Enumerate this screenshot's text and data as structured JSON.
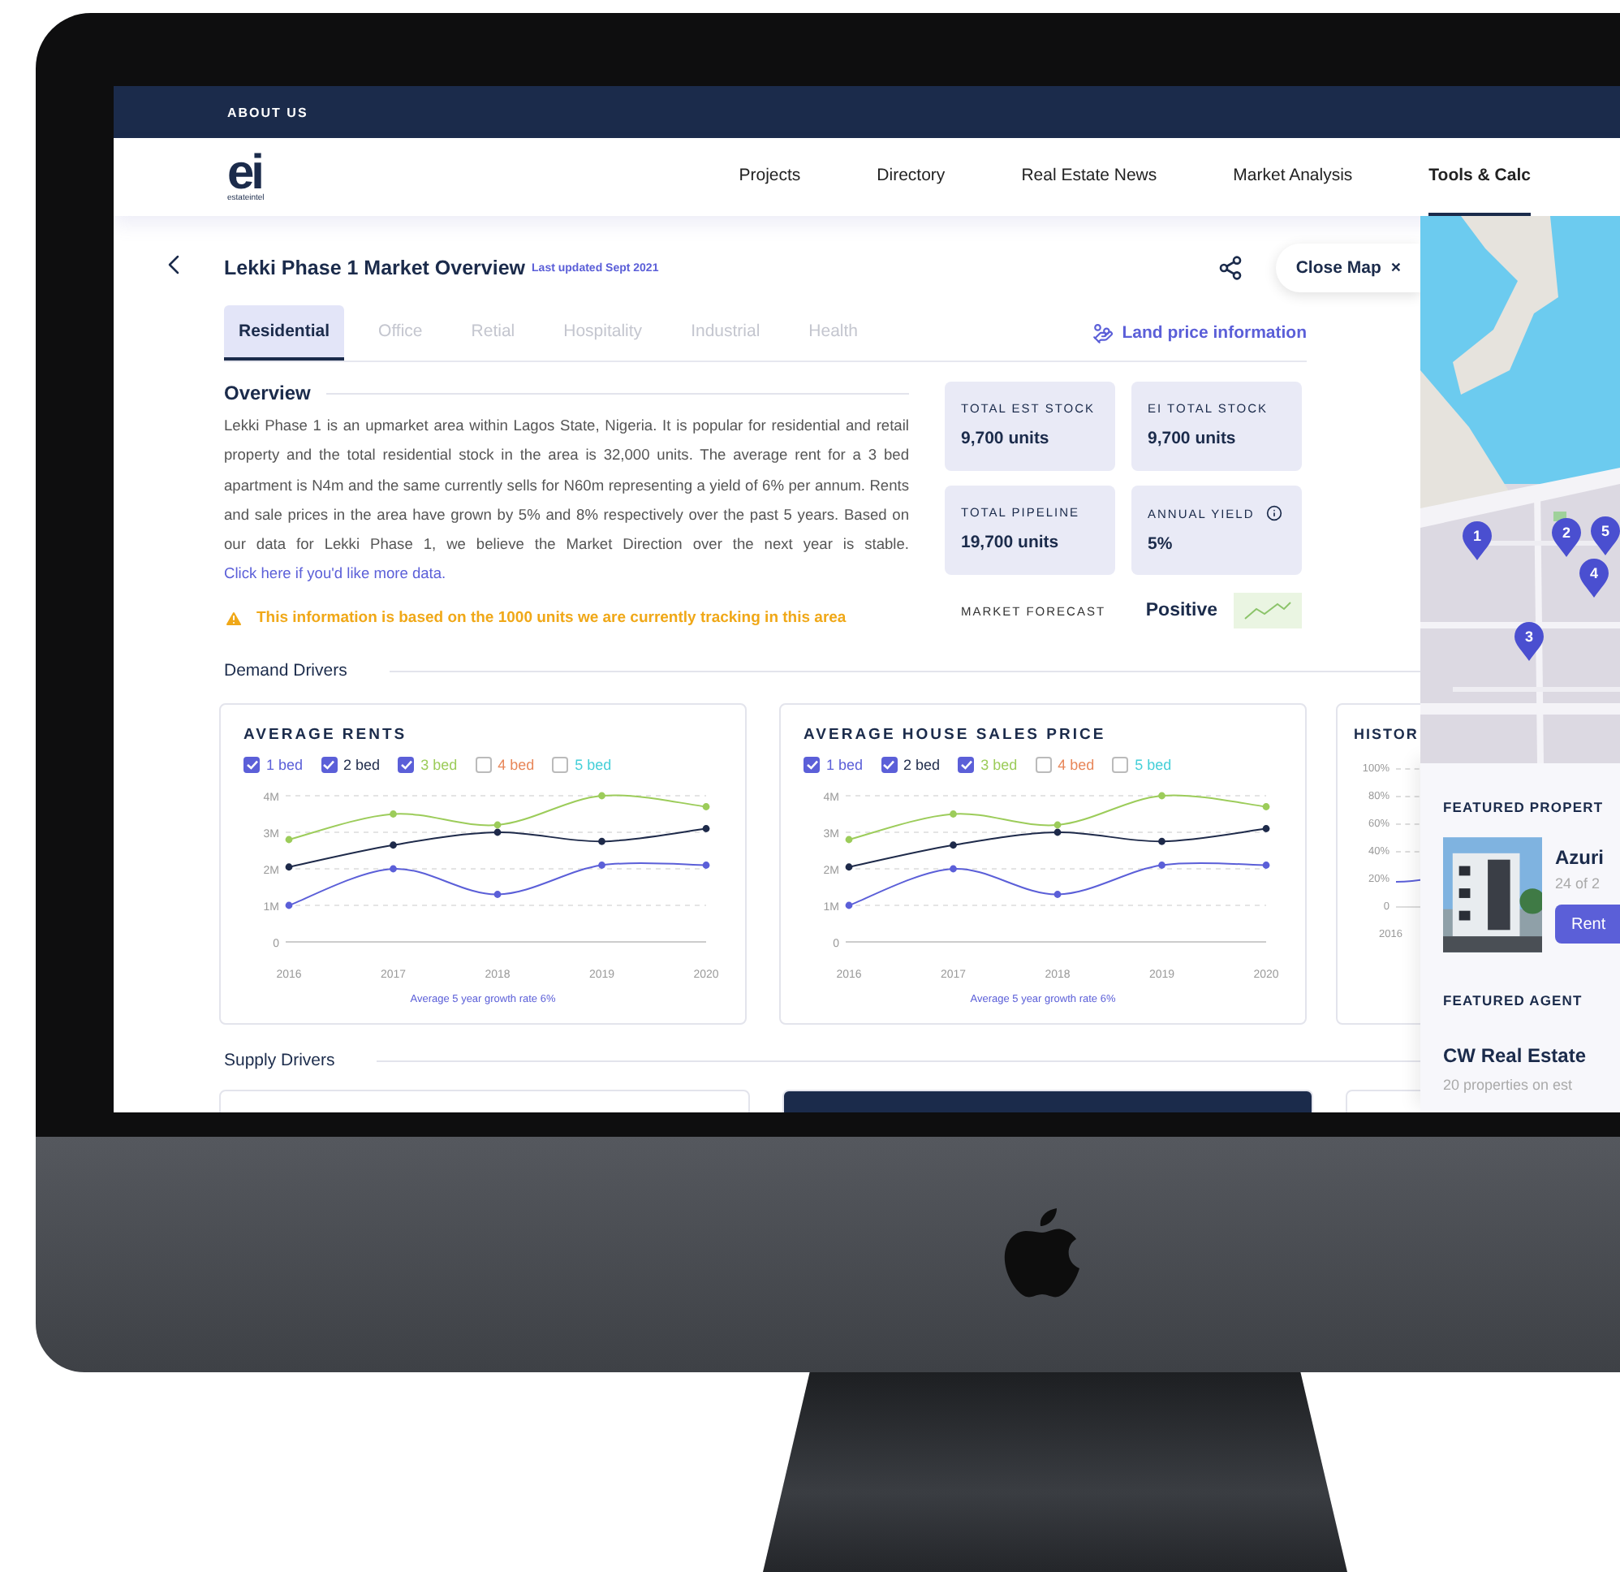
{
  "top_bar": {
    "link": "ABOUT US"
  },
  "nav": {
    "logo": "ei",
    "logo_sub": "estateintel",
    "items": [
      {
        "label": "Projects",
        "selected": false
      },
      {
        "label": "Directory",
        "selected": false
      },
      {
        "label": "Real Estate News",
        "selected": false
      },
      {
        "label": "Market Analysis",
        "selected": false
      },
      {
        "label": "Tools & Calc",
        "selected": true
      }
    ]
  },
  "header": {
    "title": "Lekki Phase 1 Market Overview",
    "updated": "Last updated Sept 2021",
    "close_map": "Close Map",
    "close_glyph": "×"
  },
  "tabs": [
    {
      "label": "Residential",
      "selected": true
    },
    {
      "label": "Office",
      "selected": false
    },
    {
      "label": "Retial",
      "selected": false
    },
    {
      "label": "Hospitality",
      "selected": false
    },
    {
      "label": "Industrial",
      "selected": false
    },
    {
      "label": "Health",
      "selected": false
    }
  ],
  "land_price": "Land price information",
  "overview": {
    "heading": "Overview",
    "text": "Lekki Phase 1 is an upmarket area within Lagos State, Nigeria. It is popular for residential and retail property and the total residential stock in the area is 32,000 units. The average rent for a 3 bed apartment is N4m and the same currently sells for N60m representing a yield of 6% per annum. Rents and sale prices in the area have grown by 5% and 8% respectively over the past 5 years. Based on our data for Lekki Phase 1, we believe the Market Direction over the next year is stable.",
    "link": "Click here if you'd like more data.",
    "notice": "This information is based on the 1000 units we are currently tracking in this area"
  },
  "stats": [
    {
      "label": "TOTAL EST STOCK",
      "value": "9,700 units",
      "info": false
    },
    {
      "label": "EI TOTAL STOCK",
      "value": "9,700 units",
      "info": false
    },
    {
      "label": "TOTAL PIPELINE",
      "value": "19,700 units",
      "info": false
    },
    {
      "label": "ANNUAL YIELD",
      "value": "5%",
      "info": true
    }
  ],
  "forecast": {
    "label": "MARKET FORECAST",
    "value": "Positive"
  },
  "demand": {
    "heading": "Demand Drivers",
    "cards": [
      {
        "title": "AVERAGE RENTS",
        "legend": [
          {
            "checked": true
          },
          {
            "checked": true
          },
          {
            "checked": true
          },
          {
            "label": "4 bed",
            "checked": false,
            "color": "#e8875a"
          },
          {
            "label": "5 bed",
            "checked": false,
            "color": "#45cfd8"
          }
        ],
        "chart_data": {
          "type": "line",
          "grid": true,
          "categories": [
            "2016",
            "2017",
            "2018",
            "2019",
            "2020"
          ],
          "ylim": [
            0,
            4
          ],
          "yticks": [
            {
              "value": 0,
              "label": "0"
            },
            {
              "value": 1,
              "label": "1M"
            },
            {
              "value": 2,
              "label": "2M"
            },
            {
              "value": 3,
              "label": "3M"
            },
            {
              "value": 4,
              "label": "4M"
            }
          ],
          "series": [
            {
              "name": "1 bed",
              "color": "#5b5fd8",
              "marker": true,
              "values": [
                1,
                2,
                1.3,
                2.1,
                2.1
              ]
            },
            {
              "name": "2 bed",
              "color": "#1e2a4a",
              "marker": true,
              "values": [
                2.05,
                2.65,
                3,
                2.75,
                3.1
              ]
            },
            {
              "name": "3 bed",
              "color": "#9ccc5a",
              "marker": true,
              "values": [
                2.8,
                3.5,
                3.2,
                4,
                3.7
              ]
            }
          ]
        },
        "footnote": "Average 5 year growth rate 6%"
      },
      {
        "title": "AVERAGE HOUSE SALES PRICE",
        "legend": [
          {
            "checked": true
          },
          {
            "checked": true
          },
          {
            "checked": true
          },
          {
            "label": "4 bed",
            "checked": false,
            "color": "#e8875a"
          },
          {
            "label": "5 bed",
            "checked": false,
            "color": "#45cfd8"
          }
        ],
        "chart_data": {
          "type": "line",
          "grid": true,
          "categories": [
            "2016",
            "2017",
            "2018",
            "2019",
            "2020"
          ],
          "ylim": [
            0,
            4
          ],
          "yticks": [
            {
              "value": 0,
              "label": "0"
            },
            {
              "value": 1,
              "label": "1M"
            },
            {
              "value": 2,
              "label": "2M"
            },
            {
              "value": 3,
              "label": "3M"
            },
            {
              "value": 4,
              "label": "4M"
            }
          ],
          "series": [
            {
              "name": "1 bed",
              "color": "#5b5fd8",
              "marker": true,
              "values": [
                1,
                2,
                1.3,
                2.1,
                2.1
              ]
            },
            {
              "name": "2 bed",
              "color": "#1e2a4a",
              "marker": true,
              "values": [
                2.05,
                2.65,
                3,
                2.75,
                3.1
              ]
            },
            {
              "name": "3 bed",
              "color": "#9ccc5a",
              "marker": true,
              "values": [
                2.8,
                3.5,
                3.2,
                4,
                3.7
              ]
            }
          ]
        },
        "footnote": "Average 5 year growth rate 6%"
      }
    ]
  },
  "history": {
    "title": "HISTOR",
    "y_labels": [
      "100%",
      "80%",
      "60%",
      "40%",
      "20%",
      "0"
    ],
    "x_label": "2016"
  },
  "supply": {
    "heading": "Supply Drivers"
  },
  "map": {
    "kind": "picture",
    "pins": [
      {
        "label": "1"
      },
      {
        "label": "2"
      },
      {
        "label": "3"
      },
      {
        "label": "5"
      },
      {
        "label": "4"
      }
    ]
  },
  "featured_property": {
    "heading": "FEATURED PROPERT",
    "name": "Azuri",
    "units": "24 of 2",
    "button": "Rent"
  },
  "featured_agent": {
    "heading": "FEATURED AGENT",
    "name": "CW Real Estate",
    "meta": "20 properties on est"
  }
}
